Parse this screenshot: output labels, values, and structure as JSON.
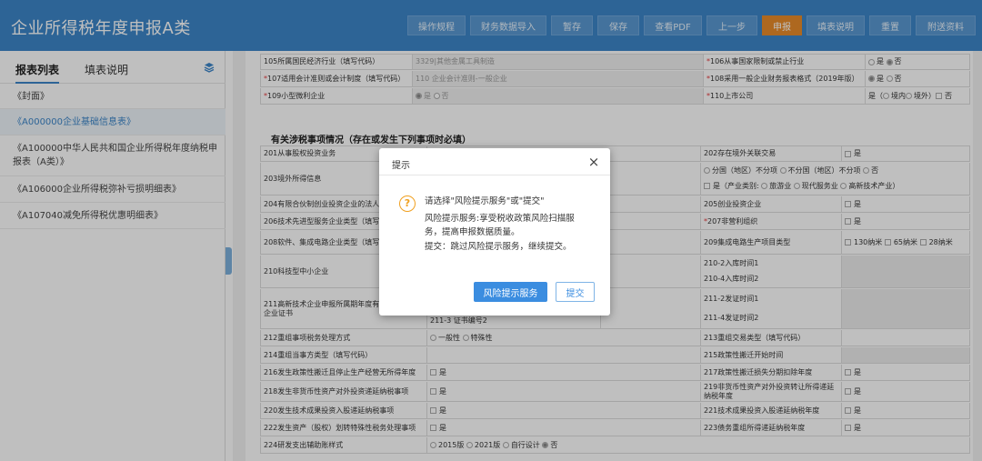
{
  "app_title": "企业所得税年度申报A类",
  "toolbar": [
    "操作规程",
    "财务数据导入",
    "暂存",
    "保存",
    "查看PDF",
    "上一步",
    "申报",
    "填表说明",
    "重置",
    "附送资料"
  ],
  "sidebar": {
    "tabs": [
      "报表列表",
      "填表说明"
    ],
    "items": [
      "《封面》",
      "《A000000企业基础信息表》",
      "《A100000中华人民共和国企业所得税年度纳税申报表（A类）》",
      "《A106000企业所得税弥补亏损明细表》",
      "《A107040减免所得税优惠明细表》"
    ]
  },
  "top_rows": {
    "r105_label": "105所属国民经济行业（填写代码）",
    "r105_value": "3329|其他金属工具制造",
    "r106_label": "106从事国家限制或禁止行业",
    "r107_label": "107适用会计准则或会计制度（填写代码）",
    "r107_value": "110 企业会计准则-一般企业",
    "r108_label": "108采用一般企业财务报表格式（2019年版）",
    "r109_label": "109小型微利企业",
    "r110_label": "110上市公司",
    "yes": "是",
    "no": "否",
    "r110_options": "是（",
    "r110_inner": "境内",
    "r110_outer": "境外）"
  },
  "section_title": "有关涉税事项情况（存在或发生下列事项时必填）",
  "rows": {
    "r201": "201从事股权投资业务",
    "r202": "202存在境外关联交易",
    "r203": "203境外所得信息",
    "r203a": "分国（地区）不分项",
    "r203b": "不分国（地区）不分项",
    "r203c": "否",
    "r203d": "是（产业类别:",
    "r203e": "旅游业",
    "r203f": "现代服务业",
    "r203g": "高新技术产业）",
    "r204": "204有限合伙制创业投资企业的法人合伙人",
    "r205": "205创业投资企业",
    "r206": "206技术先进型服务企业类型（填写代码）",
    "r207": "207非营利组织",
    "r208": "208软件、集成电路企业类型（填写代码）",
    "r209": "209集成电路生产项目类型",
    "r209opts": [
      "130纳米",
      "65纳米",
      "28纳米"
    ],
    "r210": "210科技型中小企业",
    "r210_2": "210-2入库时间1",
    "r210_4": "210-4入库时间2",
    "r211": "211高新技术企业申报所属期年度有效的高新技术企业证书",
    "r211_2": "211-2发证时间1",
    "r211_3": "211-3 证书编号2",
    "r211_4": "211-4发证时间2",
    "r212": "212重组事项税务处理方式",
    "r212a": "一般性",
    "r212b": "特殊性",
    "r213": "213重组交易类型（填写代码）",
    "r214": "214重组当事方类型（填写代码）",
    "r215": "215政策性搬迁开始时间",
    "r216": "216发生政策性搬迁且停止生产经营无所得年度",
    "r217": "217政策性搬迁损失分期扣除年度",
    "r218": "218发生非货币性资产对外投资递延纳税事项",
    "r219": "219非货币性资产对外投资转让所得递延纳税年度",
    "r220": "220发生技术成果投资入股递延纳税事项",
    "r221": "221技术成果投资入股递延纳税年度",
    "r222": "222发生资产（股权）划转特殊性税务处理事项",
    "r223": "223债务重组所得递延纳税年度",
    "r224": "224研发支出辅助账样式",
    "r224opts": [
      "2015版",
      "2021版",
      "自行设计",
      "否"
    ]
  },
  "dialog": {
    "title": "提示",
    "lines": [
      "请选择\"风险提示服务\"或\"提交\"",
      "风险提示服务:享受税收政策风险扫描服",
      "务，提高申报数据质量。",
      "提交：跳过风险提示服务，继续提交。"
    ],
    "btn_risk": "风险提示服务",
    "btn_submit": "提交",
    "close": "×"
  },
  "colors": {
    "header": "#3c86c9",
    "accent": "#e98b2a",
    "primary": "#3b8de0",
    "required": "#e4393c"
  }
}
